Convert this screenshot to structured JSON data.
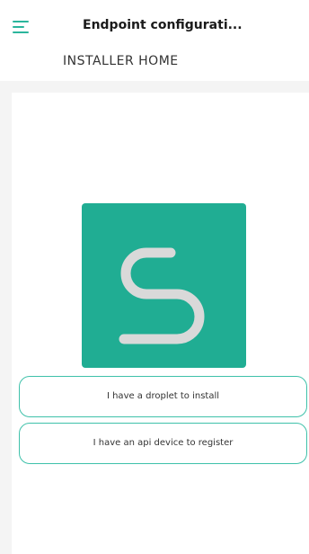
{
  "header": {
    "title": "Endpoint configurati...",
    "menu_icon": "hamburger-menu-icon"
  },
  "subheader": {
    "title": "INSTALLER HOME"
  },
  "logo": {
    "icon": "s-logo-icon",
    "background_color": "#20ad93"
  },
  "actions": {
    "droplet_label": "I have a droplet to install",
    "api_label": "I have an api device to register"
  },
  "colors": {
    "accent": "#3fc1aa"
  }
}
